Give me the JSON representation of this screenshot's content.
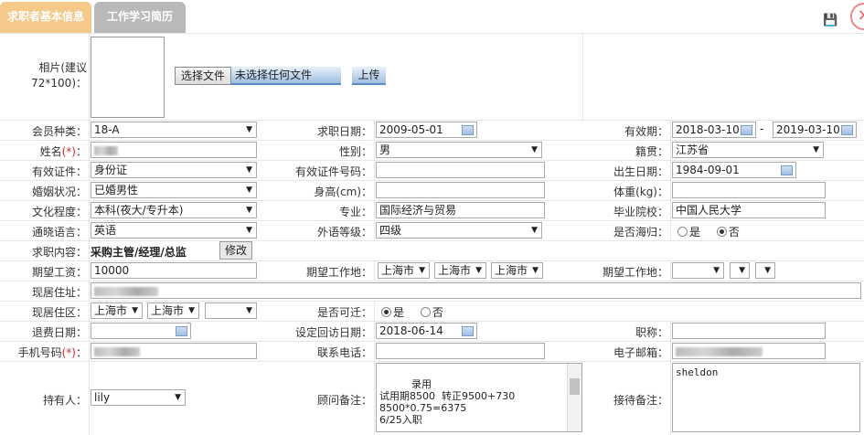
{
  "tabs": {
    "active": "求职者基本信息",
    "inactive": "工作学习简历"
  },
  "icons": {
    "save": "save-icon",
    "close": "close-icon"
  },
  "photo": {
    "label_line1": "相片(建议",
    "label_line2": "72*100)：",
    "choose_file": "选择文件",
    "no_file": "未选择任何文件",
    "upload": "上传"
  },
  "fields": {
    "member_type": {
      "label": "会员种类：",
      "value": "18-A"
    },
    "job_date": {
      "label": "求职日期：",
      "value": "2009-05-01"
    },
    "validity": {
      "label": "有效期：",
      "from": "2018-03-10",
      "sep": "-",
      "to": "2019-03-10"
    },
    "name": {
      "label": "姓名",
      "req": "(*)",
      "colon": "："
    },
    "gender": {
      "label": "性别：",
      "value": "男"
    },
    "native_place": {
      "label": "籍贯：",
      "value": "江苏省"
    },
    "id_type": {
      "label": "有效证件：",
      "value": "身份证"
    },
    "id_number": {
      "label": "有效证件号码：",
      "value": ""
    },
    "birth_date": {
      "label": "出生日期：",
      "value": "1984-09-01"
    },
    "marital": {
      "label": "婚姻状况：",
      "value": "已婚男性"
    },
    "height": {
      "label": "身高(cm)：",
      "value": ""
    },
    "weight": {
      "label": "体重(kg)：",
      "value": ""
    },
    "education": {
      "label": "文化程度：",
      "value": "本科(夜大/专升本)"
    },
    "major": {
      "label": "专业：",
      "value": "国际经济与贸易"
    },
    "school": {
      "label": "毕业院校：",
      "value": "中国人民大学"
    },
    "language": {
      "label": "通晓语言：",
      "value": "英语"
    },
    "language_level": {
      "label": "外语等级：",
      "value": "四级"
    },
    "returnee": {
      "label": "是否海归：",
      "yes": "是",
      "no": "否",
      "selected": "否"
    },
    "job_content": {
      "label": "求职内容：",
      "value": "采购主管/经理/总监",
      "edit": "修改"
    },
    "expected_salary": {
      "label": "期望工资：",
      "value": "10000"
    },
    "expected_location": {
      "label": "期望工作地：",
      "city1": "上海市",
      "city2": "上海市",
      "city3": "上海市"
    },
    "expected_location2": {
      "label": "期望工作地："
    },
    "current_address": {
      "label": "现居住址："
    },
    "current_area": {
      "label": "现居住区：",
      "city1": "上海市",
      "city2": "上海市"
    },
    "relocate": {
      "label": "是否可迁：",
      "yes": "是",
      "no": "否",
      "selected": "是"
    },
    "retire_date": {
      "label": "退费日期：",
      "value": ""
    },
    "revisit_date": {
      "label": "设定回访日期：",
      "value": "2018-06-14"
    },
    "title": {
      "label": "职称：",
      "value": ""
    },
    "mobile": {
      "label": "手机号码",
      "req": "(*)",
      "colon": "："
    },
    "phone": {
      "label": "联系电话：",
      "value": ""
    },
    "email": {
      "label": "电子邮箱："
    },
    "holder": {
      "label": "持有人：",
      "value": "lily"
    },
    "consultant_note": {
      "label": "顾问备注：",
      "text": "    录用\n试用期8500  转正9500+730\n8500*0.75=6375\n6/25入职"
    },
    "reception_note": {
      "label": "接待备注：",
      "text": "sheldon"
    }
  }
}
